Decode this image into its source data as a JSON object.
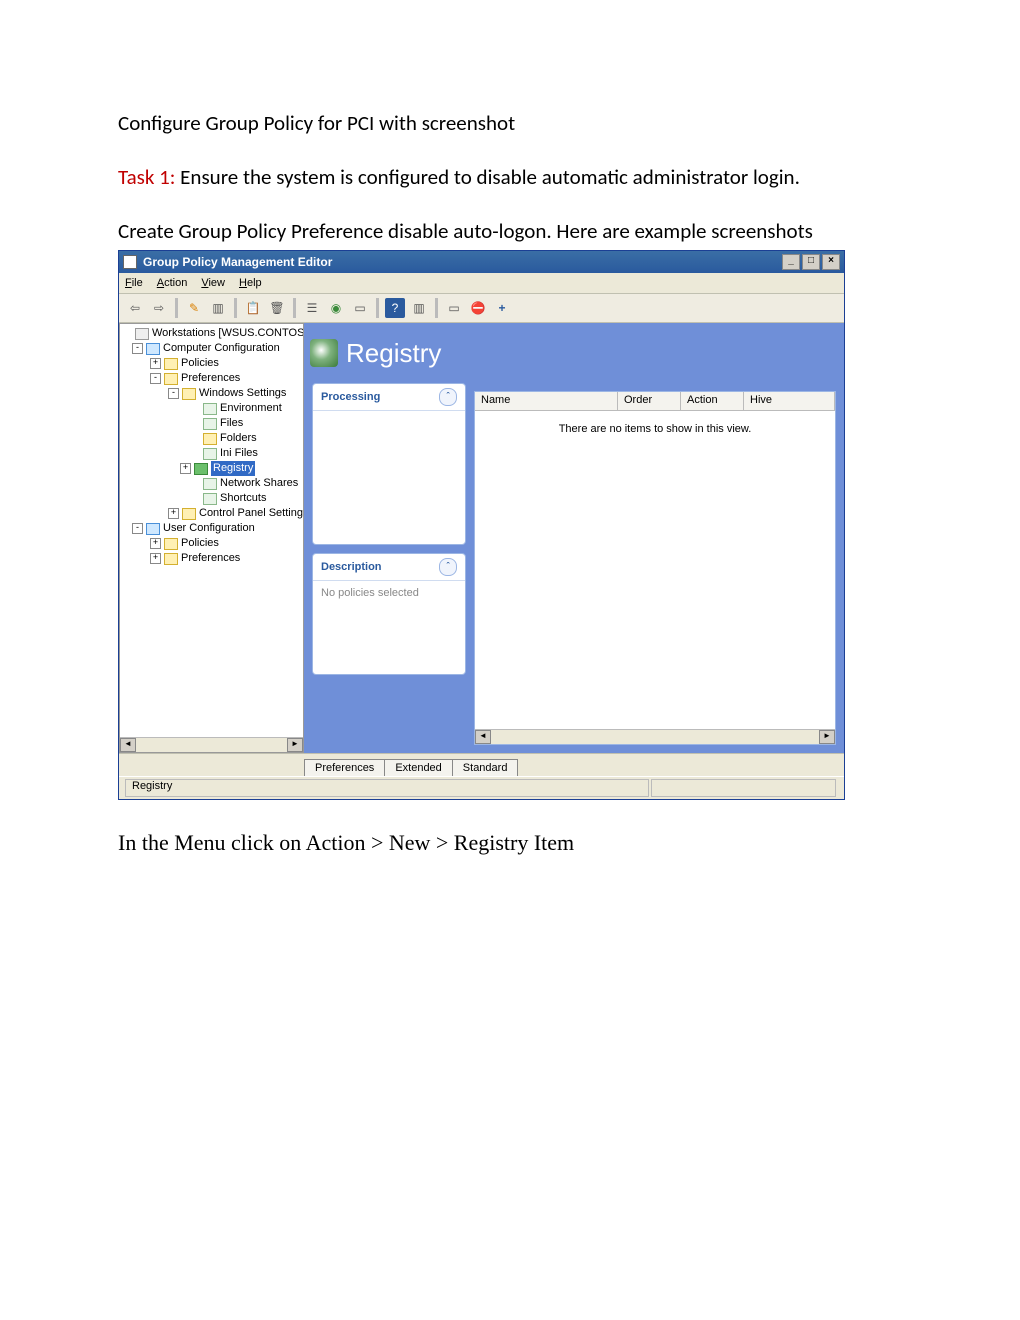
{
  "doc": {
    "title": "Configure Group Policy for PCI with screenshot",
    "task_label": "Task 1:",
    "task_text": " Ensure the system is configured to disable automatic administrator login.",
    "line2": "Create Group Policy Preference disable auto-logon. Here are example screenshots",
    "footer": "In the Menu click on Action > New > Registry Item"
  },
  "window": {
    "title": "Group Policy Management Editor",
    "min": "_",
    "max": "□",
    "close": "×"
  },
  "menus": {
    "file": "File",
    "action": "Action",
    "view": "View",
    "help": "Help"
  },
  "toolbar_glyphs": [
    "⇦",
    "⇨",
    "✎",
    "▥",
    "📋",
    "🗑",
    "🔍",
    "🟢",
    "📄",
    "?",
    "▥",
    "📄",
    "⛔",
    "+"
  ],
  "tree": {
    "root": "Workstations [WSUS.CONTOSO.LO",
    "cc": "Computer Configuration",
    "policies": "Policies",
    "prefs": "Preferences",
    "ws": "Windows Settings",
    "env": "Environment",
    "files": "Files",
    "folders": "Folders",
    "ini": "Ini Files",
    "registry": "Registry",
    "net": "Network Shares",
    "short": "Shortcuts",
    "cps": "Control Panel Settings",
    "uc": "User Configuration",
    "upolicies": "Policies",
    "uprefs": "Preferences"
  },
  "registry_header": "Registry",
  "panels": {
    "processing": "Processing",
    "description": "Description",
    "desc_text": "No policies selected"
  },
  "list": {
    "cols": {
      "name": "Name",
      "order": "Order",
      "action": "Action",
      "hive": "Hive"
    },
    "empty": "There are no items to show in this view."
  },
  "tabs": {
    "pref": "Preferences",
    "ext": "Extended",
    "std": "Standard"
  },
  "status": "Registry",
  "scroll": {
    "left": "◄",
    "right": "►"
  }
}
